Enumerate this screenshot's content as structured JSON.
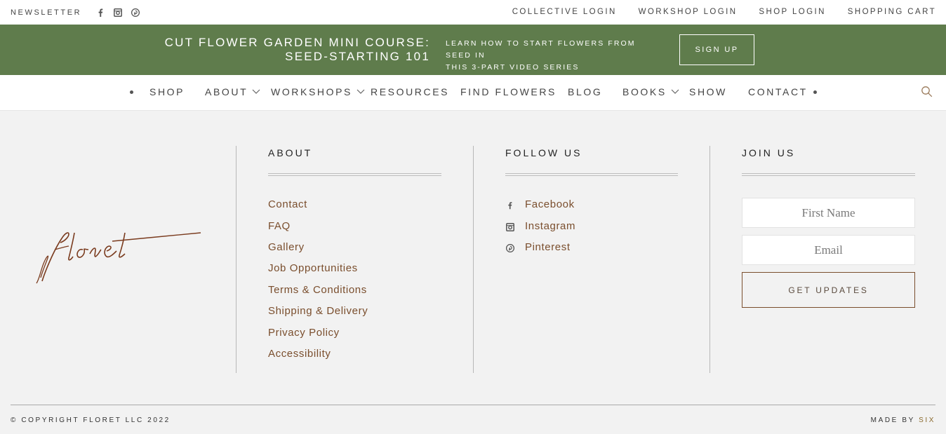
{
  "topbar": {
    "newsletter": "NEWSLETTER",
    "social_icons": [
      "facebook-icon",
      "instagram-icon",
      "pinterest-icon"
    ],
    "links": [
      "COLLECTIVE LOGIN",
      "WORKSHOP LOGIN",
      "SHOP LOGIN",
      "SHOPPING CART"
    ]
  },
  "banner": {
    "course_line1": "CUT FLOWER GARDEN MINI COURSE:",
    "course_line2": "SEED-STARTING 101",
    "desc_line1": "LEARN HOW TO START FLOWERS FROM SEED IN",
    "desc_line2": "THIS 3-PART VIDEO SERIES",
    "button": "SIGN UP",
    "background": "#5f7c4c"
  },
  "nav": {
    "items": [
      {
        "label": "SHOP"
      },
      {
        "label": "ABOUT"
      },
      {
        "label": "WORKSHOPS"
      },
      {
        "label": "RESOURCES"
      },
      {
        "label": "FIND FLOWERS"
      },
      {
        "label": "BLOG"
      },
      {
        "label": "BOOKS"
      },
      {
        "label": "SHOW"
      },
      {
        "label": "CONTACT"
      }
    ],
    "search_icon": "search-icon"
  },
  "footer": {
    "logo_text": "floret",
    "about": {
      "title": "ABOUT",
      "links": [
        "Contact",
        "FAQ",
        "Gallery",
        "Job Opportunities",
        "Terms & Conditions",
        "Shipping & Delivery",
        "Privacy Policy",
        "Accessibility"
      ]
    },
    "follow": {
      "title": "FOLLOW US",
      "links": [
        {
          "label": "Facebook",
          "icon": "facebook-icon"
        },
        {
          "label": "Instagram",
          "icon": "instagram-icon"
        },
        {
          "label": "Pinterest",
          "icon": "pinterest-icon"
        }
      ]
    },
    "join": {
      "title": "JOIN US",
      "first_name_placeholder": "First Name",
      "email_placeholder": "Email",
      "button": "GET UPDATES"
    },
    "copyright": "© COPYRIGHT FLORET LLC 2022",
    "made_by": "MADE BY",
    "made_by_link": "SIX",
    "link_color": "#7a4e2d"
  }
}
